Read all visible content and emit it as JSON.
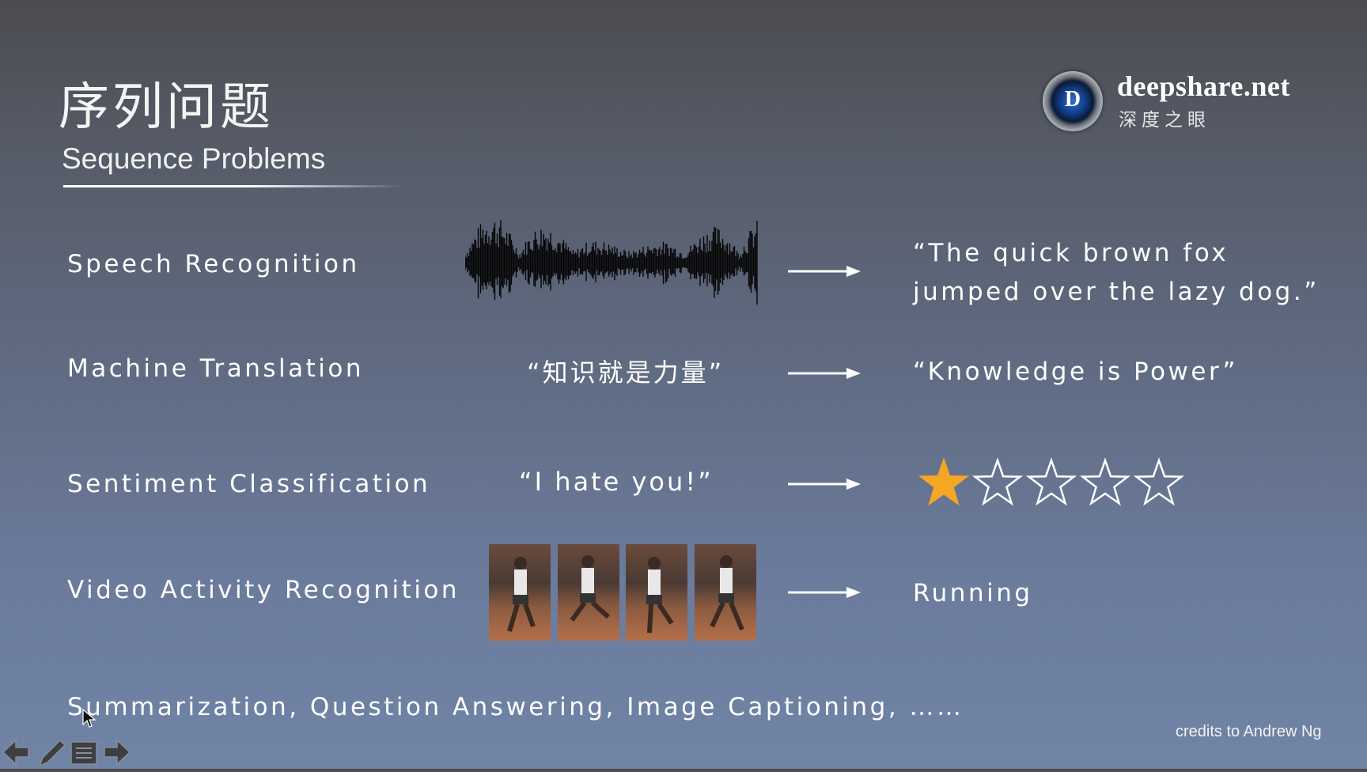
{
  "slide": {
    "title_cn": "序列问题",
    "title_en": "Sequence Problems"
  },
  "logo": {
    "name": "deepshare.net",
    "subtitle": "深度之眼",
    "mark": "D"
  },
  "rows": [
    {
      "label": "Speech Recognition",
      "output": [
        "“The quick brown fox",
        "jumped over the lazy dog.”"
      ]
    },
    {
      "label": "Machine Translation",
      "input": "“知识就是力量”",
      "output": "“Knowledge is Power”"
    },
    {
      "label": "Sentiment Classification",
      "input": "“I hate you!”",
      "rating": {
        "value": 1,
        "max": 5
      }
    },
    {
      "label": "Video Activity Recognition",
      "output": "Running"
    }
  ],
  "bottom_text": "Summarization, Question Answering, Image Captioning, ……",
  "credits": "credits to Andrew Ng",
  "colors": {
    "star_filled": "#f5a623",
    "star_outline": "#ffffff",
    "text": "#ffffff"
  },
  "nav_icons": [
    "arrow-left-icon",
    "pen-icon",
    "menu-icon",
    "arrow-right-icon"
  ]
}
